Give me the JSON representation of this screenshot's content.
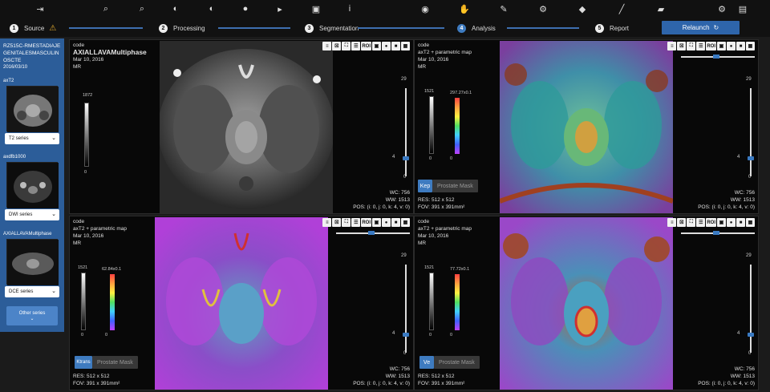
{
  "toolbar": {
    "icons": [
      "sign-in-icon",
      "search-icon",
      "search-reset-icon",
      "contrast-icon",
      "contrast-reset-icon",
      "palette-icon",
      "cursor-reset-icon",
      "unlock-icon",
      "info-icon",
      "toggle-icon",
      "hand-icon",
      "edit-icon",
      "gear-outline-icon",
      "tags-icon",
      "brush-icon",
      "eraser-icon",
      "cogs-icon",
      "file-download-icon"
    ]
  },
  "steps": [
    {
      "num": "1",
      "label": "Source"
    },
    {
      "num": "2",
      "label": "Processing"
    },
    {
      "num": "3",
      "label": "Segmentation"
    },
    {
      "num": "4",
      "label": "Analysis"
    },
    {
      "num": "5",
      "label": "Report"
    }
  ],
  "relaunch_label": "Relaunch",
  "sidebar": {
    "patient_id": "RZ515C-RMESTADIAJEGENITALESMASCULINOSCTE",
    "date": "2016/03/10",
    "series": [
      {
        "name": "axT2",
        "type": "T2 series"
      },
      {
        "name": "axdfb1000",
        "type": "DWI series"
      },
      {
        "name": "AXIALLAVAMultiphase",
        "type": "DCE series"
      }
    ],
    "other_label": "Other series"
  },
  "colors": {
    "accent": "#3e7bc0",
    "sidebar": "#2c5d99"
  },
  "panels": [
    {
      "code": "code",
      "title": "AXIALLAVAMultiphase",
      "date": "Mar 10, 2016",
      "modality": "MR",
      "cmax": "1872",
      "cmin": "0",
      "smax": "29",
      "smid": "4",
      "smin": "0",
      "wc": "WC: 756",
      "ww": "WW: 1513",
      "pos": "POS: (i: 0, j: 0, k: 4, v: 0)",
      "btn_roi": "ROI"
    },
    {
      "code": "code",
      "title": "axT2 + parametric map",
      "date": "Mar 10, 2016",
      "modality": "MR",
      "cmax": "1521",
      "cmin": "0",
      "pmax": "297.27x0.1",
      "pmin": "0",
      "smax": "29",
      "smid": "4",
      "smin": "0",
      "wc": "WC: 756",
      "ww": "WW: 1513",
      "pos": "POS: (i: 0, j: 0, k: 4, v: 0)",
      "mask_k": "Kep",
      "mask_label": "Prostate Mask",
      "res": "RES: 512 x 512",
      "fov": "FOV: 391 x 391mm²",
      "btn_roi": "ROI"
    },
    {
      "code": "code",
      "title": "axT2 + parametric map",
      "date": "Mar 10, 2016",
      "modality": "MR",
      "cmax": "1521",
      "cmin": "0",
      "pmax": "62.84x0.1",
      "pmin": "0",
      "smax": "29",
      "smid": "4",
      "smin": "0",
      "wc": "WC: 756",
      "ww": "WW: 1513",
      "pos": "POS: (i: 0, j: 0, k: 4, v: 0)",
      "mask_k": "Ktrans",
      "mask_label": "Prostate Mask",
      "res": "RES: 512 x 512",
      "fov": "FOV: 391 x 391mm²",
      "btn_roi": "ROI"
    },
    {
      "code": "code",
      "title": "axT2 + parametric map",
      "date": "Mar 10, 2016",
      "modality": "MR",
      "cmax": "1521",
      "cmin": "0",
      "pmax": "77.72x0.1",
      "pmin": "0",
      "smax": "29",
      "smid": "4",
      "smin": "0",
      "wc": "WC: 756",
      "ww": "WW: 1513",
      "pos": "POS: (i: 0, j: 0, k: 4, v: 0)",
      "mask_k": "Ve",
      "mask_label": "Prostate Mask",
      "res": "RES: 512 x 512",
      "fov": "FOV: 391 x 391mm²",
      "btn_roi": "ROI"
    }
  ]
}
